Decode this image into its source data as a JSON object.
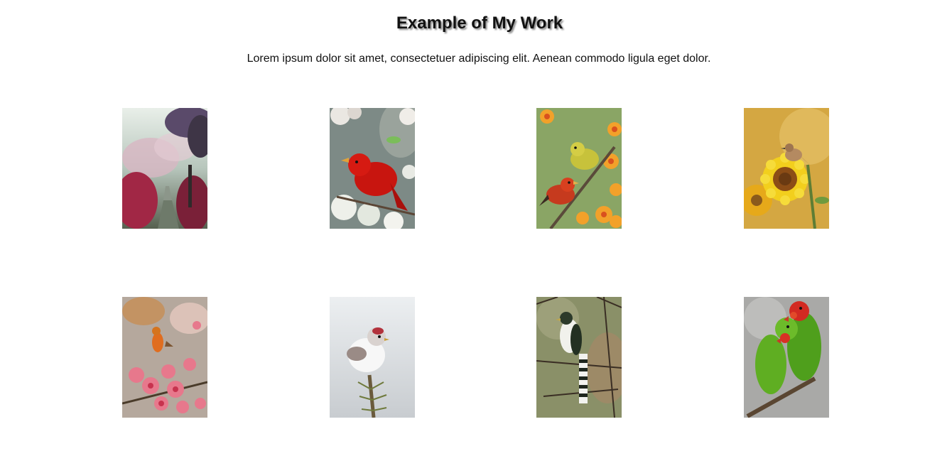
{
  "header": {
    "title": "Example of My Work",
    "description": "Lorem ipsum dolor sit amet, consectetuer adipiscing elit. Aenean commodo ligula eget dolor."
  },
  "gallery": {
    "items": [
      {
        "name": "gallery-photo-blossom-path",
        "subject": "pink blossom trees along stone path"
      },
      {
        "name": "gallery-photo-red-cardinal",
        "subject": "red bird on white blossoms"
      },
      {
        "name": "gallery-photo-two-birds-flowers",
        "subject": "yellow and red birds among orange flowers"
      },
      {
        "name": "gallery-photo-sunflower-bird",
        "subject": "small bird on sunflower"
      },
      {
        "name": "gallery-photo-robin-blossoms",
        "subject": "robin among pink blossoms"
      },
      {
        "name": "gallery-photo-white-bird",
        "subject": "white bird on pine branch"
      },
      {
        "name": "gallery-photo-cuckoo",
        "subject": "striped bird on branches"
      },
      {
        "name": "gallery-photo-lovebirds",
        "subject": "two green lovebirds on branch"
      }
    ]
  }
}
